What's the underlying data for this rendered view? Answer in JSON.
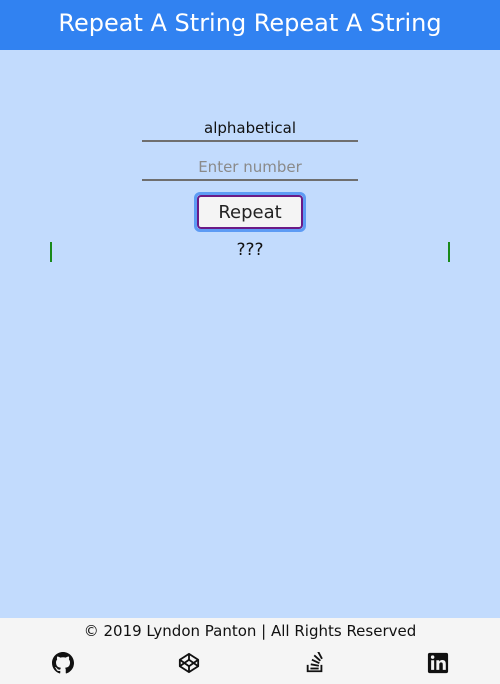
{
  "header": {
    "title": "Repeat A String Repeat A String"
  },
  "form": {
    "string_value": "alphabetical",
    "number_placeholder": "Enter number",
    "number_value": "",
    "repeat_label": "Repeat"
  },
  "output": {
    "text": "???"
  },
  "footer": {
    "copyright": "© 2019 Lyndon Panton | All Rights Reserved",
    "icons": [
      "github-icon",
      "codepen-icon",
      "stackoverflow-icon",
      "linkedin-icon"
    ]
  },
  "colors": {
    "header_bg": "#3182f1",
    "page_bg": "#c2dbfd",
    "footer_bg": "#f5f5f5",
    "button_border": "#6b1a86",
    "output_bar": "#1a8a1a"
  }
}
